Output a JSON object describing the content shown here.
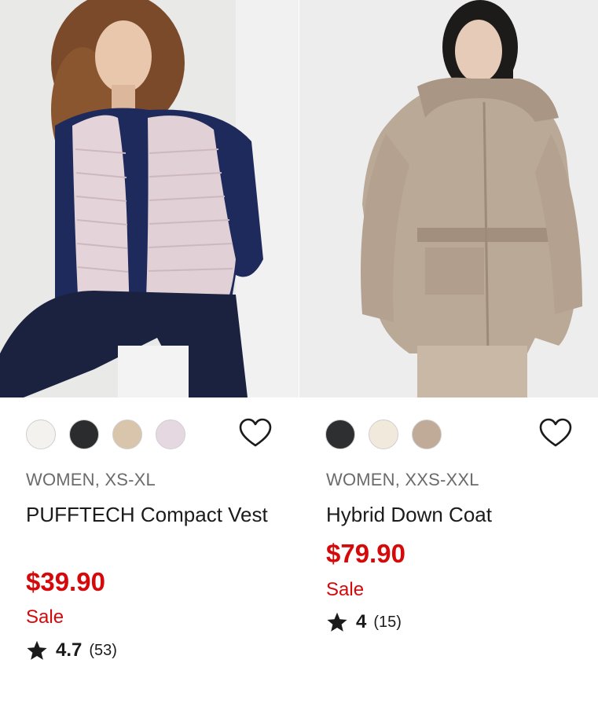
{
  "products": [
    {
      "image": "Model wearing light pink quilted vest over navy sweater",
      "swatch_colors": [
        "#f4f2ee",
        "#2b2c2e",
        "#d9c5ab",
        "#e6d8e0"
      ],
      "category": "WOMEN, XS-XL",
      "name": "PUFFTECH Compact Vest",
      "price": "$39.90",
      "sale_label": "Sale",
      "rating": "4.7",
      "review_count": "(53)",
      "favorite_icon": "heart-outline-icon"
    },
    {
      "image": "Model wearing beige hooded belted down coat",
      "swatch_colors": [
        "#2e2f31",
        "#f0e9dc",
        "#bfab98"
      ],
      "category": "WOMEN, XXS-XXL",
      "name": "Hybrid Down Coat",
      "price": "$79.90",
      "sale_label": "Sale",
      "rating": "4",
      "review_count": "(15)",
      "favorite_icon": "heart-outline-icon"
    }
  ],
  "colors": {
    "price": "#d5080a",
    "meta": "#6b6b6b",
    "text": "#1b1b1b"
  }
}
